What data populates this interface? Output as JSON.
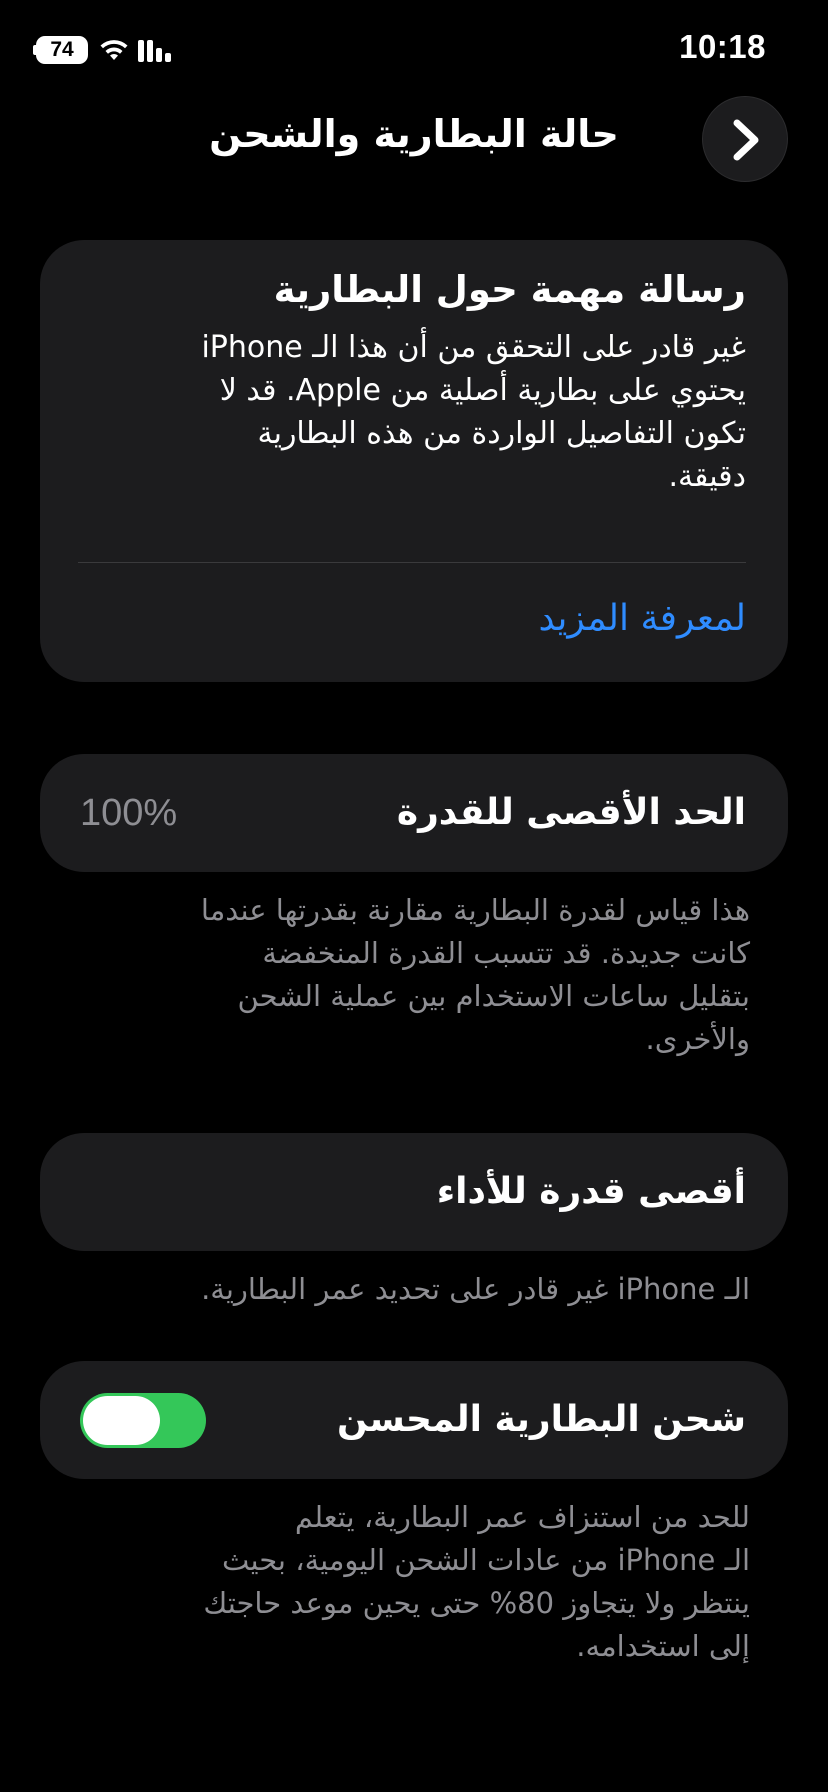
{
  "status_bar": {
    "time": "10:18",
    "battery_level": "74",
    "icons": [
      "battery-icon",
      "wifi-icon",
      "cellular-signal-icon"
    ]
  },
  "header": {
    "title": "حالة البطارية والشحن",
    "back_icon": "chevron-right-icon"
  },
  "message_card": {
    "title": "رسالة مهمة حول البطارية",
    "body_lines": [
      "غير قادر على التحقق من أن هذا الـ iPhone",
      "يحتوي على بطارية أصلية من Apple. قد لا",
      "تكون التفاصيل الواردة من هذه البطارية",
      "دقيقة."
    ],
    "link": "لمعرفة المزيد"
  },
  "maximum_capacity": {
    "label": "الحد الأقصى للقدرة",
    "value": "100%",
    "note_lines": [
      "هذا قياس لقدرة البطارية مقارنة بقدرتها عندما",
      "كانت جديدة. قد تتسبب القدرة المنخفضة",
      "بتقليل ساعات الاستخدام بين عملية الشحن",
      "والأخرى."
    ]
  },
  "peak_performance": {
    "label": "أقصى قدرة للأداء",
    "note": "الـ iPhone غير قادر على تحديد عمر البطارية."
  },
  "optimized_charging": {
    "label": "شحن البطارية المحسن",
    "enabled": true,
    "note_lines": [
      "للحد من استنزاف عمر البطارية، يتعلم",
      "الـ iPhone من عادات الشحن اليومية، بحيث",
      "ينتظر ولا يتجاوز 80% حتى يحين موعد حاجتك",
      "إلى استخدامه."
    ]
  },
  "colors": {
    "background": "#000000",
    "card": "#1c1c1e",
    "link_blue": "#2f8cff",
    "secondary_text": "#8e8e93",
    "toggle_on": "#34c759"
  }
}
